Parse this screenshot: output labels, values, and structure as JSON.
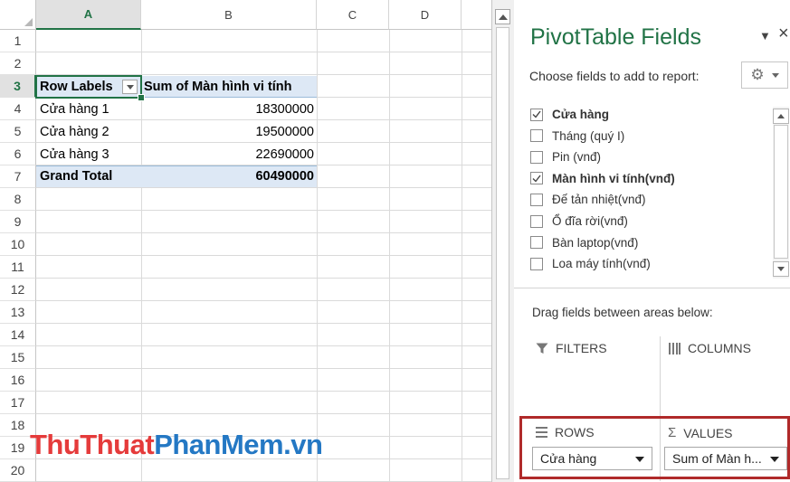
{
  "sheet": {
    "columns": [
      "A",
      "B",
      "C",
      "D"
    ],
    "rows": [
      "1",
      "2",
      "3",
      "4",
      "5",
      "6",
      "7",
      "8",
      "9",
      "10",
      "11",
      "12",
      "13",
      "14",
      "15",
      "16",
      "17",
      "18",
      "19",
      "20"
    ],
    "pivot": {
      "row_labels_header": "Row Labels",
      "value_header": "Sum of Màn hình vi tính",
      "rows": [
        {
          "label": "Cửa hàng 1",
          "value": "18300000"
        },
        {
          "label": "Cửa hàng 2",
          "value": "19500000"
        },
        {
          "label": "Cửa hàng 3",
          "value": "22690000"
        }
      ],
      "grand_total_label": "Grand Total",
      "grand_total_value": "60490000"
    },
    "watermark": {
      "part1": "ThuThuat",
      "part2": "PhanMem",
      "part3": ".vn"
    }
  },
  "pane": {
    "title": "PivotTable Fields",
    "menu_glyph": "▼",
    "close_glyph": "×",
    "choose_label": "Choose fields to add to report:",
    "gear_glyph": "⚙",
    "fields": [
      {
        "name": "Cửa hàng",
        "checked": true
      },
      {
        "name": "Tháng  (quý I)",
        "checked": false
      },
      {
        "name": "Pin (vnđ)",
        "checked": false
      },
      {
        "name": "Màn hình vi tính(vnđ)",
        "checked": true
      },
      {
        "name": "Đế tản nhiệt(vnđ)",
        "checked": false
      },
      {
        "name": "Ổ đĩa rời(vnđ)",
        "checked": false
      },
      {
        "name": "Bàn laptop(vnđ)",
        "checked": false
      },
      {
        "name": "Loa máy tính(vnđ)",
        "checked": false
      }
    ],
    "drag_label": "Drag fields between areas below:",
    "areas": {
      "filters": {
        "icon": "filter-icon",
        "label": "FILTERS"
      },
      "columns": {
        "icon": "columns-icon",
        "label": "COLUMNS"
      },
      "rows": {
        "icon": "rows-icon",
        "label": "ROWS",
        "item": "Cửa hàng"
      },
      "values": {
        "icon": "sigma-icon",
        "label": "VALUES",
        "item": "Sum of Màn h..."
      }
    },
    "highlight_color": "#b02a2a",
    "accent_color": "#217346"
  }
}
